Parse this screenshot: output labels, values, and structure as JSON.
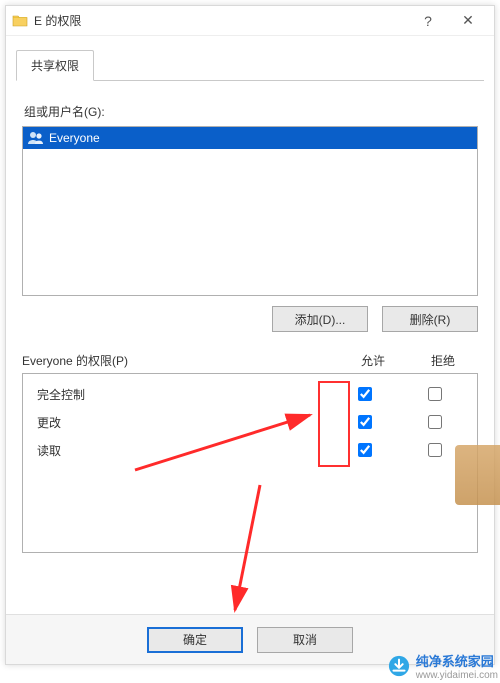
{
  "window": {
    "title": "E 的权限",
    "help_glyph": "?",
    "close_glyph": "✕"
  },
  "tabs": {
    "share": "共享权限"
  },
  "groups_label": "组或用户名(G):",
  "user_list": {
    "items": [
      {
        "name": "Everyone",
        "selected": true
      }
    ]
  },
  "buttons": {
    "add": "添加(D)...",
    "remove": "删除(R)",
    "ok": "确定",
    "cancel": "取消"
  },
  "perm_header": {
    "left": "Everyone 的权限(P)",
    "allow": "允许",
    "deny": "拒绝"
  },
  "permissions": [
    {
      "name": "完全控制",
      "allow": true,
      "deny": false
    },
    {
      "name": "更改",
      "allow": true,
      "deny": false
    },
    {
      "name": "读取",
      "allow": true,
      "deny": false
    }
  ],
  "watermark": {
    "name": "纯净系统家园",
    "url": "www.yidaimei.com"
  }
}
